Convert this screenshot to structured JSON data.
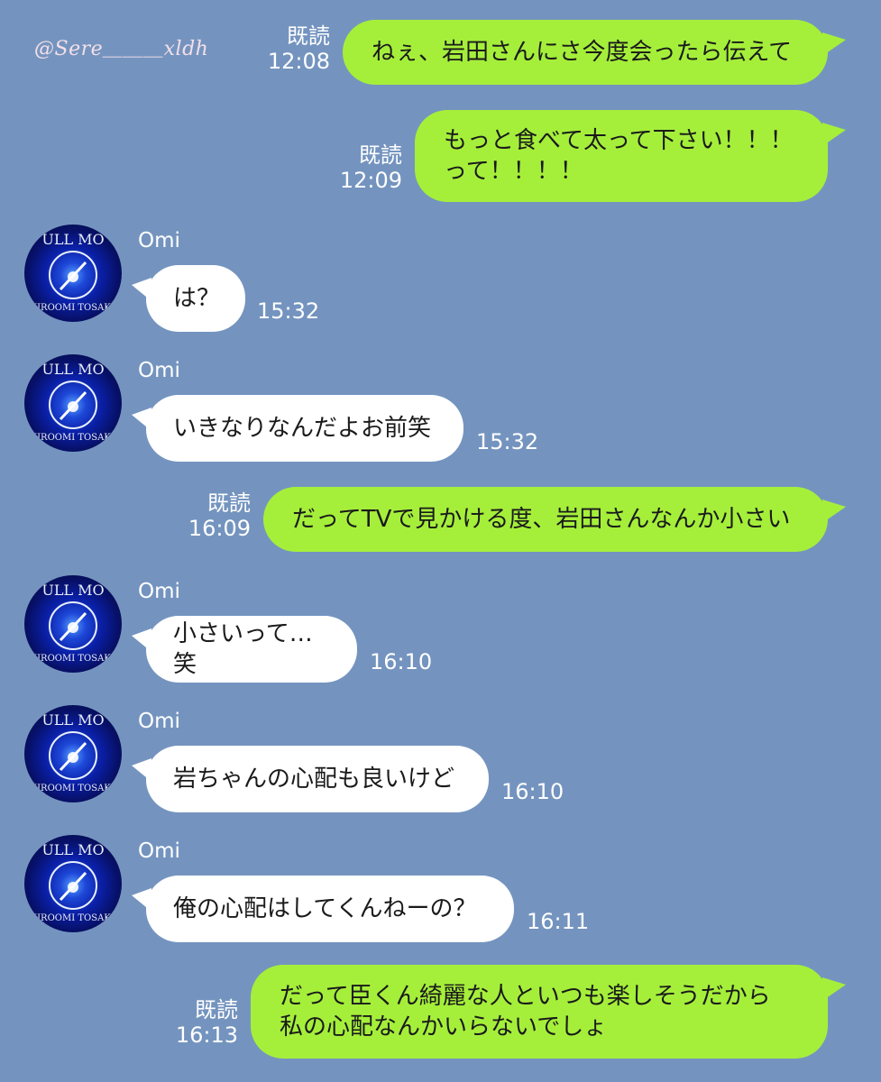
{
  "watermark": "@Sere＿＿＿xldh",
  "read_label": "既読",
  "sender_name": "Omi",
  "messages": [
    {
      "direction": "out",
      "text": "ねぇ、岩田さんにさ今度会ったら伝えて",
      "time": "12:08",
      "read": "既読"
    },
    {
      "direction": "out",
      "text": "もっと食べて太って下さい！！！\nって！！！！",
      "time": "12:09",
      "read": "既読"
    },
    {
      "direction": "in",
      "text": "は？",
      "time": "15:32",
      "sender": "Omi"
    },
    {
      "direction": "in",
      "text": "いきなりなんだよお前笑",
      "time": "15:32",
      "sender": "Omi"
    },
    {
      "direction": "out",
      "text": "だってTVで見かける度、岩田さんなんか小さい",
      "time": "16:09",
      "read": "既読"
    },
    {
      "direction": "in",
      "text": "小さいって…笑",
      "time": "16:10",
      "sender": "Omi"
    },
    {
      "direction": "in",
      "text": "岩ちゃんの心配も良いけど",
      "time": "16:10",
      "sender": "Omi"
    },
    {
      "direction": "in",
      "text": "俺の心配はしてくんねーの？",
      "time": "16:11",
      "sender": "Omi"
    },
    {
      "direction": "out",
      "text": "だって臣くん綺麗な人といつも楽しそうだから\n私の心配なんかいらないでしょ",
      "time": "16:13",
      "read": "既読"
    }
  ]
}
